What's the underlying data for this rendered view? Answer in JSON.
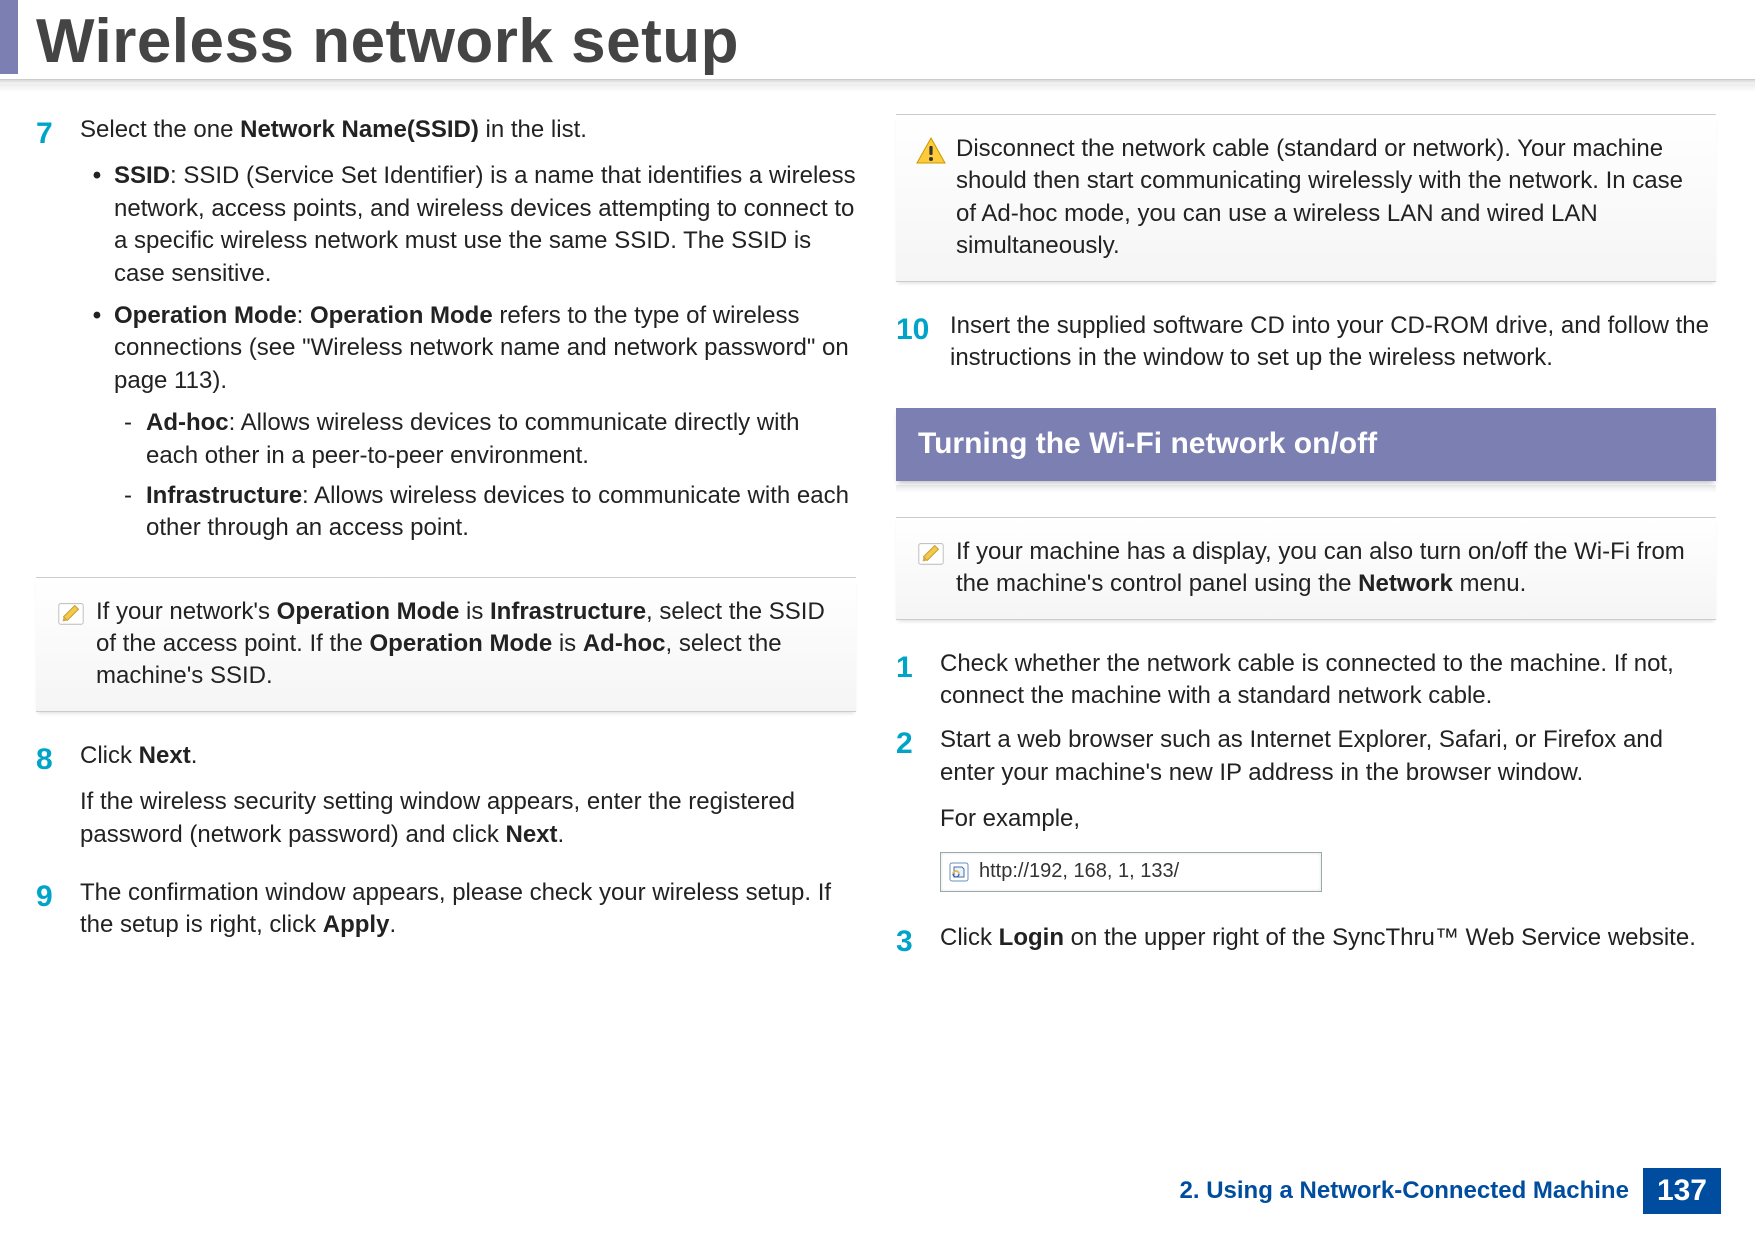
{
  "header": {
    "title": "Wireless network setup"
  },
  "left": {
    "step7": {
      "num": "7",
      "intro_a": "Select the one ",
      "intro_bold": "Network Name(SSID)",
      "intro_b": " in the list.",
      "ssid_label": "SSID",
      "ssid_text": ": SSID (Service Set Identifier) is a name that identifies a wireless network, access points, and wireless devices attempting to connect to a specific wireless network must use the same SSID. The SSID is case sensitive.",
      "op_label": "Operation Mode",
      "op_colon": ": ",
      "op_label2": "Operation Mode",
      "op_text": " refers to the type of wireless connections (see \"Wireless network name and network password\" on page 113).",
      "adhoc_label": "Ad-hoc",
      "adhoc_text": ": Allows wireless devices to communicate directly with each other in a peer-to-peer environment.",
      "infra_label": "Infrastructure",
      "infra_text": ": Allows wireless devices to communicate with each other through an access point."
    },
    "note1": {
      "a": "If your network's ",
      "b1": "Operation Mode",
      "c": " is ",
      "b2": "Infrastructure",
      "d": ", select the SSID of the access point. If the ",
      "b3": "Operation Mode",
      "e": " is ",
      "b4": "Ad-hoc",
      "f": ", select the machine's SSID."
    },
    "step8": {
      "num": "8",
      "line1_a": "Click ",
      "line1_bold": "Next",
      "line1_b": ".",
      "line2_a": "If the wireless security setting window appears, enter the registered password (network password) and click ",
      "line2_bold": "Next",
      "line2_b": "."
    },
    "step9": {
      "num": "9",
      "a": "The confirmation window appears, please check your wireless setup. If the setup is right, click ",
      "bold": "Apply",
      "b": "."
    }
  },
  "right": {
    "warn": {
      "text": "Disconnect the network cable (standard or network). Your machine should then start communicating wirelessly with the network. In case of Ad-hoc mode, you can use a wireless LAN and wired LAN simultaneously."
    },
    "step10": {
      "num": "10",
      "text": "Insert the supplied software CD into your CD-ROM drive, and follow the instructions in the window to set up the wireless network."
    },
    "section_title": "Turning the Wi-Fi network on/off",
    "note2": {
      "a": "If your machine has a display, you can also turn on/off the Wi-Fi from the machine's control panel using the ",
      "bold": "Network",
      "b": " menu."
    },
    "step1": {
      "num": "1",
      "text": "Check whether the network cable is connected to the machine. If not, connect the machine with a standard network cable."
    },
    "step2": {
      "num": "2",
      "text": "Start a web browser such as Internet Explorer, Safari, or Firefox and enter your machine's new IP address in the browser window.",
      "example_label": "For example,",
      "url": "http://192, 168, 1, 133/"
    },
    "step3": {
      "num": "3",
      "a": "Click ",
      "bold": "Login",
      "b": " on the upper right of the SyncThru™ Web Service website."
    }
  },
  "footer": {
    "chapter": "2.  Using a Network-Connected Machine",
    "page": "137"
  }
}
